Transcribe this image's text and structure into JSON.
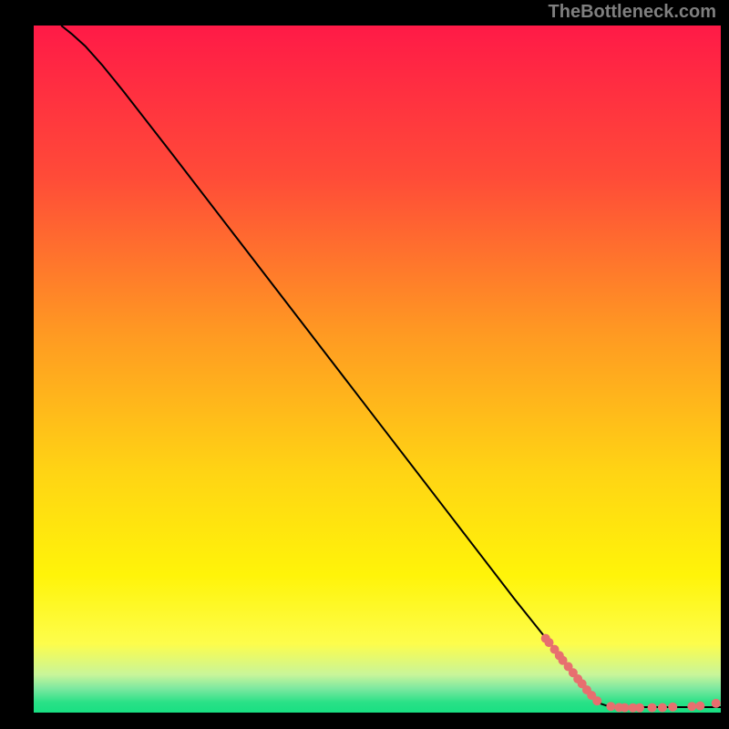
{
  "attribution": "TheBottleneck.com",
  "chart_data": {
    "type": "line",
    "title": "",
    "xlabel": "",
    "ylabel": "",
    "xlim": [
      0,
      100
    ],
    "ylim": [
      0,
      100
    ],
    "grid": false,
    "legend": false,
    "background_gradient_stops": [
      {
        "offset": 0.0,
        "color": "#ff1a47"
      },
      {
        "offset": 0.22,
        "color": "#ff4b38"
      },
      {
        "offset": 0.45,
        "color": "#ff9a22"
      },
      {
        "offset": 0.65,
        "color": "#ffd414"
      },
      {
        "offset": 0.8,
        "color": "#fff409"
      },
      {
        "offset": 0.9,
        "color": "#fdfd4c"
      },
      {
        "offset": 0.945,
        "color": "#c8f59a"
      },
      {
        "offset": 0.965,
        "color": "#7de8a0"
      },
      {
        "offset": 0.985,
        "color": "#2ae187"
      },
      {
        "offset": 1.0,
        "color": "#18df82"
      }
    ],
    "curve": [
      {
        "x": 4.0,
        "y": 100.0
      },
      {
        "x": 5.5,
        "y": 98.8
      },
      {
        "x": 7.5,
        "y": 97.0
      },
      {
        "x": 10.0,
        "y": 94.2
      },
      {
        "x": 13.0,
        "y": 90.5
      },
      {
        "x": 20.0,
        "y": 81.5
      },
      {
        "x": 30.0,
        "y": 68.5
      },
      {
        "x": 40.0,
        "y": 55.5
      },
      {
        "x": 50.0,
        "y": 42.5
      },
      {
        "x": 60.0,
        "y": 29.5
      },
      {
        "x": 70.0,
        "y": 16.5
      },
      {
        "x": 78.0,
        "y": 6.5
      },
      {
        "x": 82.5,
        "y": 1.3
      },
      {
        "x": 84.0,
        "y": 0.8
      },
      {
        "x": 90.0,
        "y": 0.8
      },
      {
        "x": 100.0,
        "y": 0.8
      }
    ],
    "markers": [
      {
        "x": 74.5,
        "y": 10.8,
        "r": 5
      },
      {
        "x": 75.0,
        "y": 10.2,
        "r": 5
      },
      {
        "x": 75.8,
        "y": 9.2,
        "r": 5
      },
      {
        "x": 76.5,
        "y": 8.3,
        "r": 5
      },
      {
        "x": 77.0,
        "y": 7.6,
        "r": 5
      },
      {
        "x": 77.8,
        "y": 6.7,
        "r": 5
      },
      {
        "x": 78.5,
        "y": 5.8,
        "r": 5
      },
      {
        "x": 79.2,
        "y": 4.9,
        "r": 5
      },
      {
        "x": 79.8,
        "y": 4.2,
        "r": 5
      },
      {
        "x": 80.5,
        "y": 3.3,
        "r": 5
      },
      {
        "x": 81.2,
        "y": 2.5,
        "r": 5
      },
      {
        "x": 82.0,
        "y": 1.7,
        "r": 5
      },
      {
        "x": 84.0,
        "y": 0.9,
        "r": 5
      },
      {
        "x": 85.2,
        "y": 0.75,
        "r": 5
      },
      {
        "x": 86.0,
        "y": 0.72,
        "r": 5
      },
      {
        "x": 87.2,
        "y": 0.7,
        "r": 5
      },
      {
        "x": 88.2,
        "y": 0.7,
        "r": 5
      },
      {
        "x": 90.0,
        "y": 0.72,
        "r": 5
      },
      {
        "x": 91.5,
        "y": 0.73,
        "r": 5
      },
      {
        "x": 93.0,
        "y": 0.82,
        "r": 5
      },
      {
        "x": 95.8,
        "y": 0.9,
        "r": 5
      },
      {
        "x": 97.0,
        "y": 0.98,
        "r": 5
      },
      {
        "x": 99.3,
        "y": 1.35,
        "r": 5
      }
    ],
    "marker_color": "#e76f6f",
    "curve_color": "#000000"
  }
}
